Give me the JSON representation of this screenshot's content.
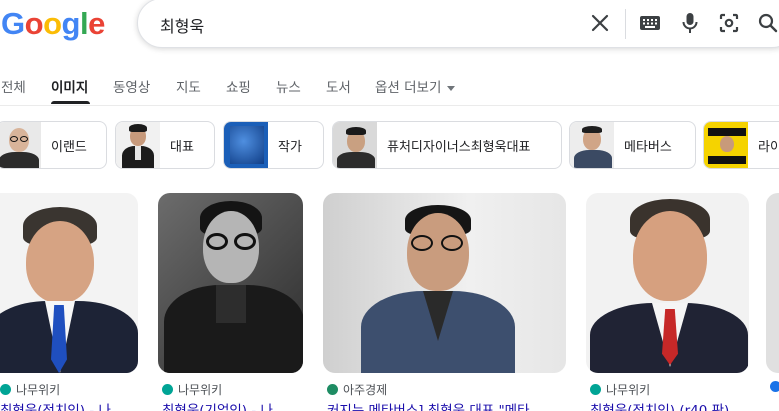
{
  "logo": {
    "letters": [
      "G",
      "o",
      "o",
      "g",
      "l",
      "e"
    ],
    "colors": [
      "#4285F4",
      "#EA4335",
      "#FBBC05",
      "#4285F4",
      "#34A853",
      "#EA4335"
    ]
  },
  "search": {
    "query": "최형욱"
  },
  "icons": {
    "clear": "close-icon",
    "keyboard": "keyboard-icon",
    "mic": "microphone-icon",
    "lens": "lens-icon",
    "search": "search-icon"
  },
  "tabs": [
    {
      "label": "전체"
    },
    {
      "label": "이미지",
      "active": true
    },
    {
      "label": "동영상"
    },
    {
      "label": "지도"
    },
    {
      "label": "쇼핑"
    },
    {
      "label": "뉴스"
    },
    {
      "label": "도서"
    },
    {
      "label": "옵션 더보기"
    }
  ],
  "chips": [
    {
      "label": "이랜드"
    },
    {
      "label": "대표"
    },
    {
      "label": "작가"
    },
    {
      "label": "퓨처디자이너스최형욱대표"
    },
    {
      "label": "메타버스"
    },
    {
      "label": "라이"
    }
  ],
  "results": [
    {
      "source": "나무위키",
      "title": "최형욱(정치인) - 나",
      "favicon_color": "#00a495"
    },
    {
      "source": "나무위키",
      "title": "최형욱(기업인) - 나",
      "favicon_color": "#00a495"
    },
    {
      "source": "아주경제",
      "title": "커지는 메타버스] 최형욱 대표 \"메타",
      "favicon_color": "#1e8c63"
    },
    {
      "source": "나무위키",
      "title": "최형욱(정치인) (r40 판)",
      "favicon_color": "#00a495"
    },
    {
      "source": "",
      "title": "",
      "favicon_color": "#1a73e8"
    }
  ]
}
